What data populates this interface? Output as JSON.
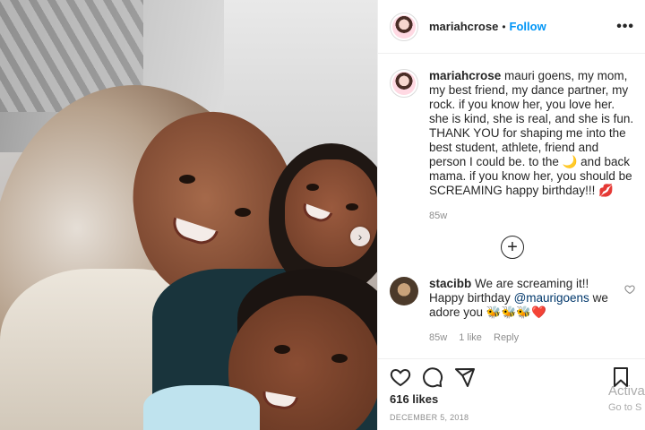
{
  "header": {
    "username": "mariahcrose",
    "separator": "•",
    "follow_label": "Follow",
    "more_label": "•••"
  },
  "caption": {
    "username": "mariahcrose",
    "text_before_moon": " mauri goens, my mom, my best friend, my dance partner, my rock. if you know her, you love her. she is kind, she is real, and she is fun. THANK YOU for shaping me into the best student, athlete, friend and person I could be. to the ",
    "moon_emoji": "🌙",
    "text_after_moon": " and back mama. if you know her, you should be SCREAMING happy birthday!!! ",
    "lips_emoji": "💋",
    "age": "85w"
  },
  "load_more_label": "+",
  "comment": {
    "username": "stacibb",
    "text_before_mention": " We are screaming it!! Happy birthday ",
    "mention": "@maurigoens",
    "text_after_mention": " we adore you ",
    "emojis": "🐝🐝🐝❤️",
    "age": "85w",
    "likes": "1 like",
    "reply_label": "Reply"
  },
  "likes_count": "616 likes",
  "date": "DECEMBER 5, 2018",
  "watermark": {
    "line1": "Activa",
    "line2": "Go to S"
  },
  "photo_next_label": "›",
  "colors": {
    "accent": "#0095f6",
    "text": "#262626",
    "muted": "#8e8e8e",
    "mention": "#00376b"
  },
  "icons": [
    "heart-icon",
    "comment-icon",
    "share-icon",
    "bookmark-icon",
    "add-icon",
    "more-icon"
  ]
}
